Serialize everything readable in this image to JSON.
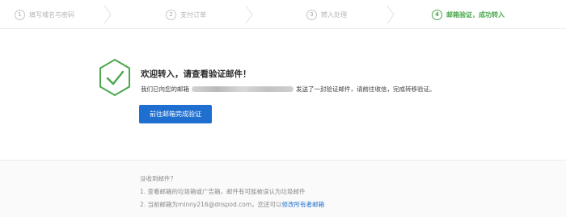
{
  "steps": [
    {
      "num": "1",
      "label": "填写域名与密码"
    },
    {
      "num": "2",
      "label": "支付订单"
    },
    {
      "num": "3",
      "label": "转入处理"
    },
    {
      "num": "4",
      "label": "邮箱验证，成功转入"
    }
  ],
  "main": {
    "title": "欢迎转入，请查看验证邮件！",
    "desc_prefix": "我们已向您的邮箱",
    "desc_suffix": "发送了一封验证邮件，请前往收信，完成转移验证。",
    "button_label": "前往邮箱完成验证"
  },
  "notes": {
    "heading": "没收到邮件？",
    "item1": "1. 查看邮箱的垃圾箱或广告箱，邮件有可能被误认为垃圾邮件",
    "item2_prefix": "2. 当前邮箱为minny216@dnspod.com，您还可以",
    "item2_link": "修改所有者邮箱"
  },
  "colors": {
    "accent_green": "#4aa84d",
    "button_blue": "#1f6fd0"
  },
  "icons": {
    "success": "hexagon-check-icon",
    "step_separator": "chevron-right-icon"
  }
}
